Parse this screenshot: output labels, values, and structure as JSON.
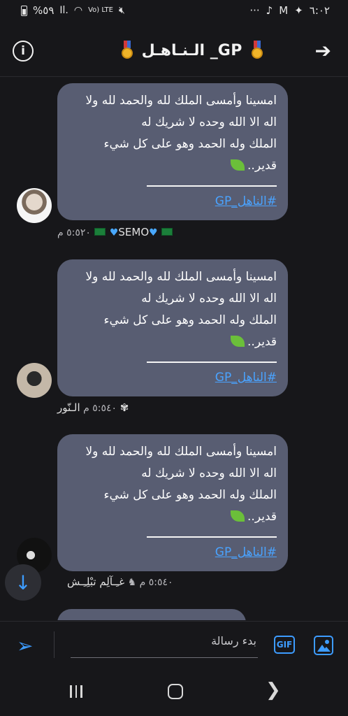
{
  "status_bar": {
    "battery": "%٥٩",
    "signal": "Il.",
    "lte": "Vo) LTE",
    "time": "٦:٠٢",
    "dots": "···"
  },
  "header": {
    "title": "الـنـاهـل _GP",
    "info_icon": "info-icon",
    "back_icon": "arrow-right-icon"
  },
  "messages": [
    {
      "lines": [
        "امسينا وأمسى الملك لله والحمد لله ولا",
        "اله الا الله وحده لا شريك له",
        "الملك وله الحمد وهو على كل شيء",
        "قدير.."
      ],
      "hashtag": "#الناهل_GP",
      "sender": "SEMO",
      "time": "٥:٥٢٠ م"
    },
    {
      "lines": [
        "امسينا وأمسى الملك لله والحمد لله ولا",
        "اله الا الله وحده لا شريك له",
        "الملك وله الحمد وهو على كل شيء",
        "قدير.."
      ],
      "hashtag": "#الناهل_GP",
      "sender": "الـنّور ✾",
      "time": "٥:٥٤٠ م"
    },
    {
      "lines": [
        "امسينا وأمسى الملك لله والحمد لله ولا",
        "اله الا الله وحده لا شريك له",
        "الملك وله الحمد وهو على كل شيء",
        "قدير.."
      ],
      "hashtag": "#الناهل_GP",
      "sender": "غـِـآلِم تبْلِـِـش",
      "time": "٥:٥٤٠ م"
    }
  ],
  "composer": {
    "placeholder": "بدء رسالة",
    "gif_label": "GIF"
  },
  "colors": {
    "bubble": "#585d72",
    "accent": "#3d9cff",
    "background": "#17171a"
  }
}
